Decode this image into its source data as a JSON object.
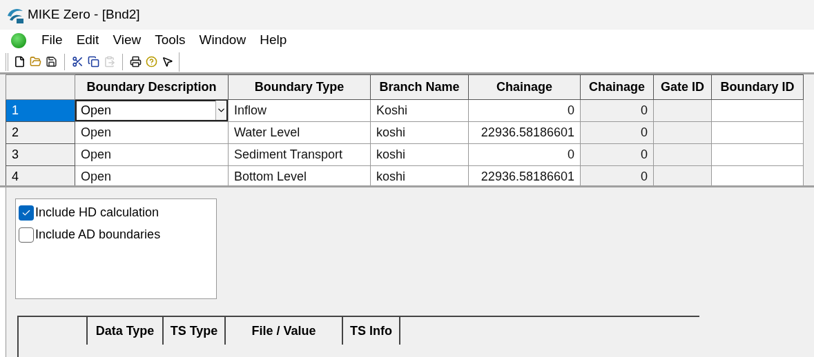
{
  "window": {
    "title": "MIKE Zero - [Bnd2]"
  },
  "menu": [
    "File",
    "Edit",
    "View",
    "Tools",
    "Window",
    "Help"
  ],
  "toolbar": [
    {
      "kind": "new",
      "disabled": false
    },
    {
      "kind": "open",
      "disabled": false
    },
    {
      "kind": "save",
      "disabled": false
    },
    {
      "kind": "sep"
    },
    {
      "kind": "cut",
      "disabled": false
    },
    {
      "kind": "copy",
      "disabled": false
    },
    {
      "kind": "paste",
      "disabled": true
    },
    {
      "kind": "sep"
    },
    {
      "kind": "print",
      "disabled": false
    },
    {
      "kind": "help",
      "disabled": false
    },
    {
      "kind": "context_help",
      "disabled": false
    }
  ],
  "table": {
    "columns": [
      {
        "label": "Boundary Description",
        "readonly": false
      },
      {
        "label": "Boundary Type",
        "readonly": false
      },
      {
        "label": "Branch Name",
        "readonly": false
      },
      {
        "label": "Chainage",
        "readonly": false
      },
      {
        "label": "Chainage",
        "readonly": true
      },
      {
        "label": "Gate ID",
        "readonly": true
      },
      {
        "label": "Boundary ID",
        "readonly": false
      }
    ],
    "rows": [
      {
        "header": "1",
        "selected": true,
        "cells": [
          "Open",
          "Inflow",
          "Koshi",
          "0",
          "0",
          "",
          ""
        ]
      },
      {
        "header": "2",
        "selected": false,
        "cells": [
          "Open",
          "Water Level",
          "koshi",
          "22936.58186601",
          "0",
          "",
          ""
        ]
      },
      {
        "header": "3",
        "selected": false,
        "cells": [
          "Open",
          "Sediment Transport",
          "koshi",
          "0",
          "0",
          "",
          ""
        ]
      },
      {
        "header": "4",
        "selected": false,
        "cells": [
          "Open",
          "Bottom Level",
          "koshi",
          "22936.58186601",
          "0",
          "",
          ""
        ]
      }
    ]
  },
  "options": [
    {
      "label": "Include HD calculation",
      "checked": true
    },
    {
      "label": "Include AD boundaries",
      "checked": false
    }
  ],
  "data_table": {
    "columns": [
      "Data Type",
      "TS Type",
      "File / Value",
      "TS Info"
    ]
  }
}
